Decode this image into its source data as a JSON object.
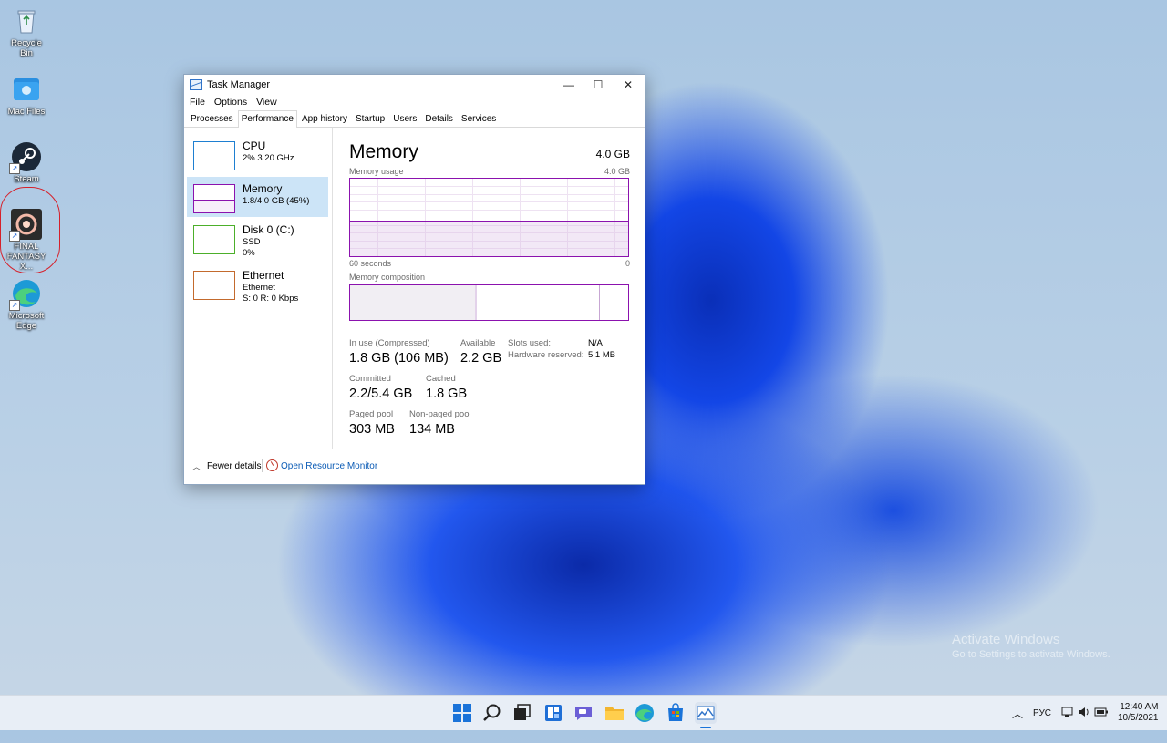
{
  "desktop": {
    "icons": [
      {
        "label": "Recycle Bin",
        "icon": "recycle-bin-icon"
      },
      {
        "label": "Mac Files",
        "icon": "folder-icon"
      },
      {
        "label": "Steam",
        "icon": "steam-icon"
      },
      {
        "label": "FINAL FANTASY X...",
        "icon": "final-fantasy-icon"
      },
      {
        "label": "Microsoft Edge",
        "icon": "edge-icon"
      }
    ]
  },
  "window": {
    "title": "Task Manager",
    "controls": {
      "minimize": "—",
      "maximize": "☐",
      "close": "✕"
    },
    "menu": [
      "File",
      "Options",
      "View"
    ],
    "tabs": [
      "Processes",
      "Performance",
      "App history",
      "Startup",
      "Users",
      "Details",
      "Services"
    ],
    "active_tab": "Performance",
    "sidebar": [
      {
        "name": "CPU",
        "line1": "2% 3.20 GHz",
        "line2": "",
        "color": "#1e7fd1"
      },
      {
        "name": "Memory",
        "line1": "1.8/4.0 GB (45%)",
        "line2": "",
        "color": "#8b12ae"
      },
      {
        "name": "Disk 0 (C:)",
        "line1": "SSD",
        "line2": "0%",
        "color": "#4caf2a"
      },
      {
        "name": "Ethernet",
        "line1": "Ethernet",
        "line2": "S: 0 R: 0 Kbps",
        "color": "#c36a2d"
      }
    ],
    "memory": {
      "title": "Memory",
      "total": "4.0 GB",
      "usage_label": "Memory usage",
      "usage_max": "4.0 GB",
      "time_left": "60 seconds",
      "time_right": "0",
      "composition_label": "Memory composition",
      "usage_fraction": 0.45,
      "stats": {
        "in_use_label": "In use (Compressed)",
        "in_use_value": "1.8 GB (106 MB)",
        "available_label": "Available",
        "available_value": "2.2 GB",
        "slots_label": "Slots used:",
        "slots_value": "N/A",
        "hw_label": "Hardware reserved:",
        "hw_value": "5.1 MB",
        "committed_label": "Committed",
        "committed_value": "2.2/5.4 GB",
        "cached_label": "Cached",
        "cached_value": "1.8 GB",
        "paged_label": "Paged pool",
        "paged_value": "303 MB",
        "nonpaged_label": "Non-paged pool",
        "nonpaged_value": "134 MB"
      }
    },
    "footer": {
      "fewer": "Fewer details",
      "open_rm": "Open Resource Monitor"
    }
  },
  "watermark": {
    "line1": "Activate Windows",
    "line2": "Go to Settings to activate Windows."
  },
  "taskbar": {
    "apps": [
      "start-icon",
      "search-icon",
      "task-view-icon",
      "widgets-icon",
      "chat-icon",
      "file-explorer-icon",
      "edge-icon",
      "store-icon",
      "task-manager-icon"
    ],
    "lang": "РУС",
    "time": "12:40 AM",
    "date": "10/5/2021"
  }
}
